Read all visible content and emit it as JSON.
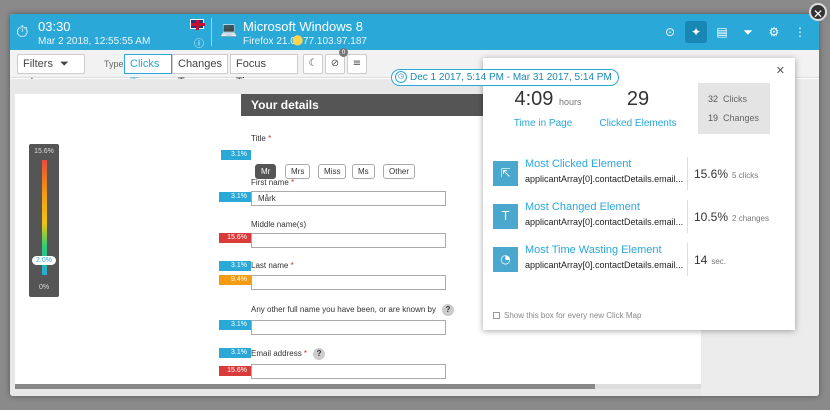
{
  "session": {
    "time": "03:30",
    "date": "Mar 2 2018, 12:55:55 AM",
    "os": "Microsoft Windows 8",
    "browser": "Firefox 21.0",
    "ip": "77.103.97.187",
    "info_glyph": "ⓘ"
  },
  "toolbar": {
    "filters_label": "Filters",
    "type_label": "Type:",
    "clicks_label": "Clicks",
    "changes_label": "Changes",
    "focus_label": "Focus Time",
    "badge_count": "0",
    "date_range": "Dec 1 2017, 5:14 PM - Mar 31 2017, 5:14 PM"
  },
  "gauge": {
    "max": "15.6%",
    "min": "0%",
    "marker": "2.0%",
    "marker_fraction": 0.13
  },
  "form": {
    "heading": "Your details",
    "title_label": "Title",
    "titles": [
      "Mr",
      "Mrs",
      "Miss",
      "Ms",
      "Other"
    ],
    "first_name_label": "First name",
    "first_name_value": "Mårk",
    "middle_label": "Middle name(s)",
    "last_label": "Last name",
    "other_label": "Any other full name you have been, or are known by",
    "email_label": "Email address",
    "req": "*",
    "help": "?"
  },
  "tags": {
    "t1": "3.1%",
    "t2": "3.1%",
    "t3": "15.6%",
    "t4": "3.1%",
    "t5": "9.4%",
    "t6": "3.1%",
    "t7": "3.1%",
    "t8": "15.6%"
  },
  "popup": {
    "close": "✕",
    "time_value": "4:09",
    "time_unit": "hours",
    "time_caption": "Time in Page",
    "clicked_value": "29",
    "clicked_caption": "Clicked Elements",
    "clicks_count": "32",
    "clicks_word": "Clicks",
    "changes_count": "19",
    "changes_word": "Changes",
    "rows": [
      {
        "title": "Most Clicked Element",
        "sub": "applicantArray[0].contactDetails.email...",
        "value": "15.6%",
        "unit": "5 clicks"
      },
      {
        "title": "Most Changed Element",
        "sub": "applicantArray[0].contactDetails.email...",
        "value": "10.5%",
        "unit": "2 changes"
      },
      {
        "title": "Most Time Wasting Element",
        "sub": "applicantArray[0].contactDetails.email...",
        "value": "14",
        "unit": "sec."
      }
    ],
    "footer": "Show this box for every new Click Map"
  },
  "colors": {
    "accent": "#2aa8d8",
    "dark": "#555555",
    "red": "#d93b3b",
    "orange": "#f39c12"
  }
}
